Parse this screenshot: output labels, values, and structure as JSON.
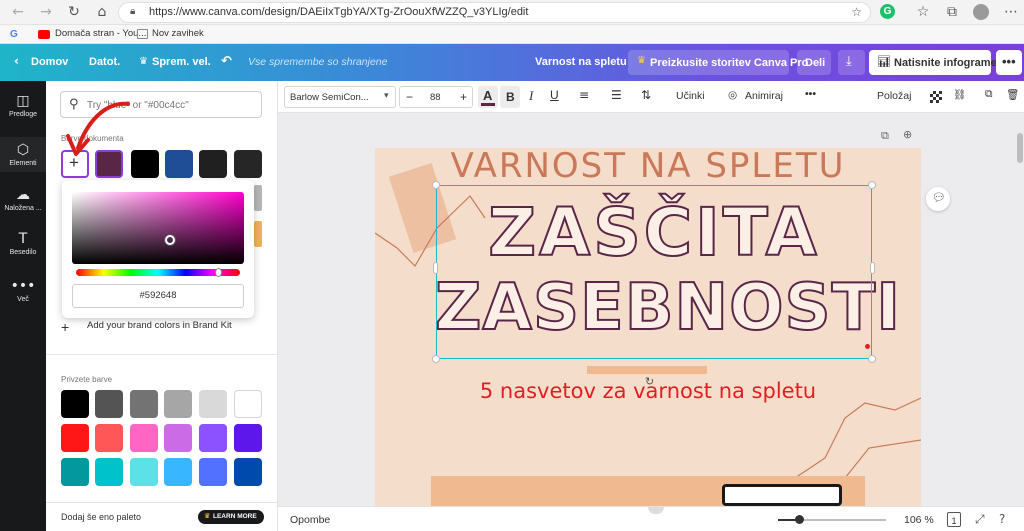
{
  "browser": {
    "url": "https://www.canva.com/design/DAEiIxTgbYA/XTg-ZrOouXfWZZQ_v3YLIg/edit",
    "bookmarks": [
      "Domača stran - You...",
      "Nov zavihek"
    ]
  },
  "topbar": {
    "home": "Domov",
    "file": "Datot.",
    "resize": "Sprem. vel.",
    "saved_status": "Vse spremembe so shranjene",
    "design_title": "Varnost na spletu",
    "pro_button": "Preizkusite storitev Canva Pro",
    "share_button": "Deli",
    "print_button": "Natisnite infograme"
  },
  "rail": {
    "items": [
      "Predloge",
      "Elementi",
      "Naložena ...",
      "Besedilo",
      "Več"
    ]
  },
  "panel": {
    "search_placeholder": "Try \"blue\" or \"#00c4cc\"",
    "doc_colors_label": "Barve dokumenta",
    "doc_colors": [
      "#592648",
      "#000000",
      "#1f4e96",
      "#202020",
      "#262626"
    ],
    "picker_hex": "#592648",
    "brand_kit_label": "Add your brand colors in Brand Kit",
    "default_colors_label": "Privzete barve",
    "default_colors": [
      [
        "#000000",
        "#545454",
        "#737373",
        "#a6a6a6",
        "#d9d9d9",
        "#ffffff"
      ],
      [
        "#ff1616",
        "#ff5757",
        "#ff66c4",
        "#cb6ce6",
        "#8c52ff",
        "#5e17eb"
      ],
      [
        "#03989e",
        "#00c2cb",
        "#5ce1e6",
        "#38b6ff",
        "#5271ff",
        "#004aad"
      ]
    ],
    "add_palette": "Dodaj še eno paleto",
    "learn_more": "LEARN MORE"
  },
  "toolbar": {
    "font": "Barlow SemiCon...",
    "font_size": "88",
    "effects": "Učinki",
    "animate": "Animiraj",
    "position": "Položaj"
  },
  "design": {
    "heading": "VARNOST NA SPLETU",
    "title_line1": "ZAŠČITA",
    "title_line2": "ZASEBNOSTI",
    "subtitle": "5 nasvetov za varnost na spletu"
  },
  "bottom": {
    "notes": "Opombe",
    "zoom": "106 %",
    "page_number": "1"
  },
  "colors": {
    "accent": "#592648",
    "page_bg": "#f5ddcb",
    "heading": "#c9795a",
    "subtitle": "#e02020",
    "selection": "#1bb8c9"
  }
}
